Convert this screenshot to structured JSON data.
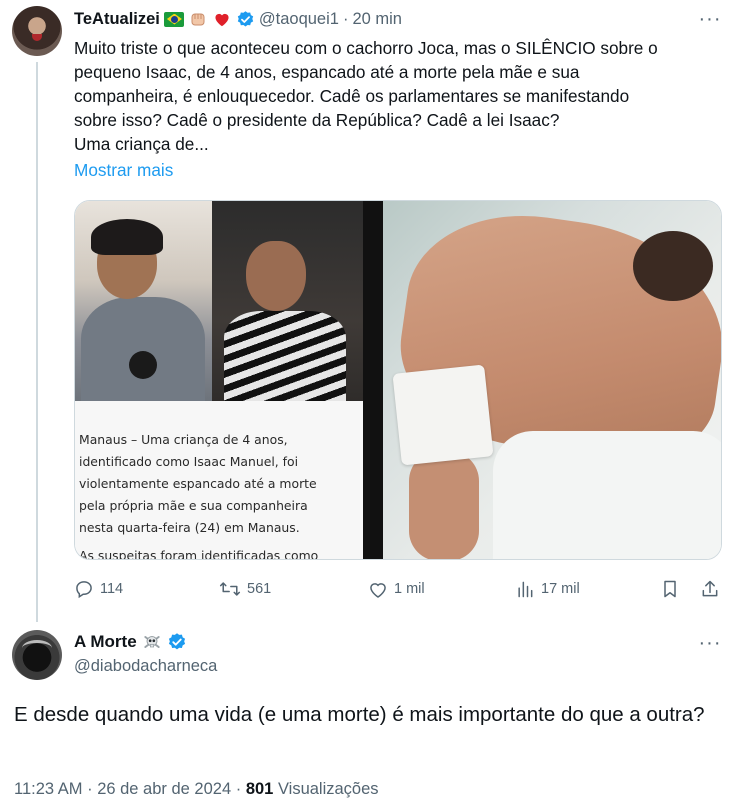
{
  "tweet1": {
    "author_name": "TeAtualizei",
    "emojis": [
      "flag-brazil-icon",
      "fist-icon",
      "red-heart-icon"
    ],
    "handle": "@taoquei1",
    "separator": "·",
    "time": "20 min",
    "text_lines": [
      "Muito triste o que aconteceu com o cachorro Joca, mas o SILÊNCIO sobre o",
      "pequeno Isaac, de 4 anos, espancado até a morte pela mãe e sua",
      "companheira, é enlouquecedor. Cadê os parlamentares se manifestando",
      "sobre isso? Cadê o presidente da República? Cadê a lei Isaac?",
      "Uma criança de..."
    ],
    "show_more": "Mostrar mais",
    "media_caption_lines": [
      "Manaus – Uma criança de 4 anos,",
      "identificado como Isaac Manuel, foi",
      "violentamente espancado até a morte",
      "pela própria mãe e sua companheira",
      "nesta quarta-feira (24) em Manaus."
    ],
    "media_caption_cut": "As suspeitas foram identificadas como",
    "actions": {
      "replies": "114",
      "reposts": "561",
      "likes": "1 mil",
      "views": "17 mil"
    }
  },
  "tweet2": {
    "author_name": "A Morte",
    "emojis": [
      "skull-crossbones-icon"
    ],
    "handle": "@diabodacharneca",
    "text": "E desde quando uma vida (e uma morte) é mais importante do que a outra?",
    "time": "11:23 AM",
    "date": "26 de abr de 2024",
    "views_count": "801",
    "views_label": "Visualizações",
    "separator": "·"
  },
  "colors": {
    "text": "#0f1419",
    "muted": "#536471",
    "link": "#1d9bf0",
    "verified": "#1d9bf0",
    "border": "#cfd9de"
  }
}
